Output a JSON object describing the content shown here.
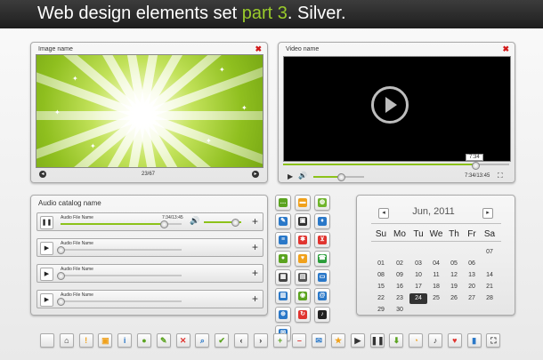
{
  "header": {
    "title_main": "Web design elements set ",
    "title_accent": "part 3",
    "title_end": ". Silver."
  },
  "colors": {
    "accent": "#9acb2b",
    "close": "#d21a1a",
    "progress": "#8cc21a"
  },
  "image_panel": {
    "title": "Image name",
    "close_icon": "✖",
    "counter": "23/67",
    "prev_icon": "◂",
    "next_icon": "▸"
  },
  "video_panel": {
    "title": "Video name",
    "close_icon": "✖",
    "time": "7:34/13:45",
    "tooltip": "7:34",
    "progress": 0.85,
    "volume": 0.55,
    "play_icon": "▶",
    "volume_icon": "🔊",
    "fullscreen_icon": "⛶"
  },
  "audio_panel": {
    "title": "Audio catalog name",
    "plus_icon": "+",
    "volume_icon": "🔊",
    "tracks": [
      {
        "name": "Audio File Name",
        "time": "7:34/13:45",
        "button": "❚❚",
        "progress": 0.85
      },
      {
        "name": "Audio File Name",
        "time": "",
        "button": "▶",
        "progress": 0
      },
      {
        "name": "Audio File Name",
        "time": "",
        "button": "▶",
        "progress": 0
      },
      {
        "name": "Audio File Name",
        "time": "",
        "button": "▶",
        "progress": 0
      }
    ]
  },
  "icon_grid": [
    {
      "name": "chat-icon",
      "color": "#5aa31f",
      "glyph": "…"
    },
    {
      "name": "folder-icon",
      "color": "#f0a11c",
      "glyph": "▬"
    },
    {
      "name": "globe-icon",
      "color": "#6fb52c",
      "glyph": "◍"
    },
    {
      "name": "pin-icon",
      "color": "#2a78c8",
      "glyph": "✎"
    },
    {
      "name": "save-icon",
      "color": "#333333",
      "glyph": "▣"
    },
    {
      "name": "mic-icon",
      "color": "#2a78c8",
      "glyph": "♦"
    },
    {
      "name": "equalizer-icon",
      "color": "#2a78c8",
      "glyph": "≡"
    },
    {
      "name": "snowflake-icon",
      "color": "#e0342f",
      "glyph": "✱"
    },
    {
      "name": "cart-icon",
      "color": "#e0342f",
      "glyph": "⊻"
    },
    {
      "name": "camera-icon",
      "color": "#5aa31f",
      "glyph": "●"
    },
    {
      "name": "bulb-icon",
      "color": "#f0a11c",
      "glyph": "♥"
    },
    {
      "name": "phone-icon",
      "color": "#2a9d3a",
      "glyph": "☎"
    },
    {
      "name": "calendar-icon",
      "color": "#444444",
      "glyph": "▦"
    },
    {
      "name": "chart-icon",
      "color": "#555555",
      "glyph": "▤"
    },
    {
      "name": "clipboard-icon",
      "color": "#2a78c8",
      "glyph": "▭"
    },
    {
      "name": "printer-icon",
      "color": "#2a78c8",
      "glyph": "▥"
    },
    {
      "name": "eye-icon",
      "color": "#5aa31f",
      "glyph": "◉"
    },
    {
      "name": "at-icon",
      "color": "#2a78c8",
      "glyph": "@"
    },
    {
      "name": "gamepad-icon",
      "color": "#2a78c8",
      "glyph": "⊕"
    },
    {
      "name": "refresh-icon",
      "color": "#e0342f",
      "glyph": "↻"
    },
    {
      "name": "music-icon",
      "color": "#222222",
      "glyph": "♪"
    },
    {
      "name": "mail-icon",
      "color": "#2a78c8",
      "glyph": "✉"
    }
  ],
  "calendar": {
    "month": "Jun, 2011",
    "prev_icon": "◂",
    "next_icon": "▸",
    "weekdays": [
      "Su",
      "Mo",
      "Tu",
      "We",
      "Th",
      "Fr",
      "Sa"
    ],
    "selected": "24",
    "weeks": [
      [
        "",
        "",
        "",
        "",
        "",
        "",
        "07"
      ],
      [
        "01",
        "02",
        "03",
        "04",
        "05",
        "06",
        ""
      ],
      [
        "08",
        "09",
        "10",
        "11",
        "12",
        "13",
        "14"
      ],
      [
        "15",
        "16",
        "17",
        "18",
        "19",
        "20",
        "21"
      ],
      [
        "22",
        "23",
        "24",
        "25",
        "26",
        "27",
        "28"
      ],
      [
        "29",
        "30",
        "",
        "",
        "",
        "",
        ""
      ]
    ]
  },
  "toolbar": [
    {
      "name": "blank-icon",
      "color": "#ffffff",
      "glyph": ""
    },
    {
      "name": "home-icon",
      "color": "#333333",
      "glyph": "⌂"
    },
    {
      "name": "warning-icon",
      "color": "#f0a11c",
      "glyph": "!"
    },
    {
      "name": "lock-icon",
      "color": "#f0a11c",
      "glyph": "▣"
    },
    {
      "name": "info-icon",
      "color": "#2a78c8",
      "glyph": "i"
    },
    {
      "name": "user-icon",
      "color": "#5aa31f",
      "glyph": "●"
    },
    {
      "name": "edit-icon",
      "color": "#5aa31f",
      "glyph": "✎"
    },
    {
      "name": "close-icon",
      "color": "#e0342f",
      "glyph": "✕"
    },
    {
      "name": "search-icon",
      "color": "#2a78c8",
      "glyph": "⌕"
    },
    {
      "name": "check-icon",
      "color": "#5aa31f",
      "glyph": "✔"
    },
    {
      "name": "chevron-left-icon",
      "color": "#333333",
      "glyph": "‹"
    },
    {
      "name": "chevron-right-icon",
      "color": "#333333",
      "glyph": "›"
    },
    {
      "name": "plus-icon",
      "color": "#5aa31f",
      "glyph": "+"
    },
    {
      "name": "minus-icon",
      "color": "#e0342f",
      "glyph": "–"
    },
    {
      "name": "mail-icon",
      "color": "#2a78c8",
      "glyph": "✉"
    },
    {
      "name": "star-icon",
      "color": "#f0a11c",
      "glyph": "★"
    },
    {
      "name": "play-icon",
      "color": "#333333",
      "glyph": "▶"
    },
    {
      "name": "pause-icon",
      "color": "#333333",
      "glyph": "❚❚"
    },
    {
      "name": "download-icon",
      "color": "#5aa31f",
      "glyph": "⬇"
    },
    {
      "name": "rss-icon",
      "color": "#f0a11c",
      "glyph": "◔"
    },
    {
      "name": "volume-icon",
      "color": "#333333",
      "glyph": "♪"
    },
    {
      "name": "heart-icon",
      "color": "#e0342f",
      "glyph": "♥"
    },
    {
      "name": "stats-icon",
      "color": "#2a78c8",
      "glyph": "▮"
    },
    {
      "name": "fullscreen-icon",
      "color": "#333333",
      "glyph": "⛶"
    }
  ]
}
